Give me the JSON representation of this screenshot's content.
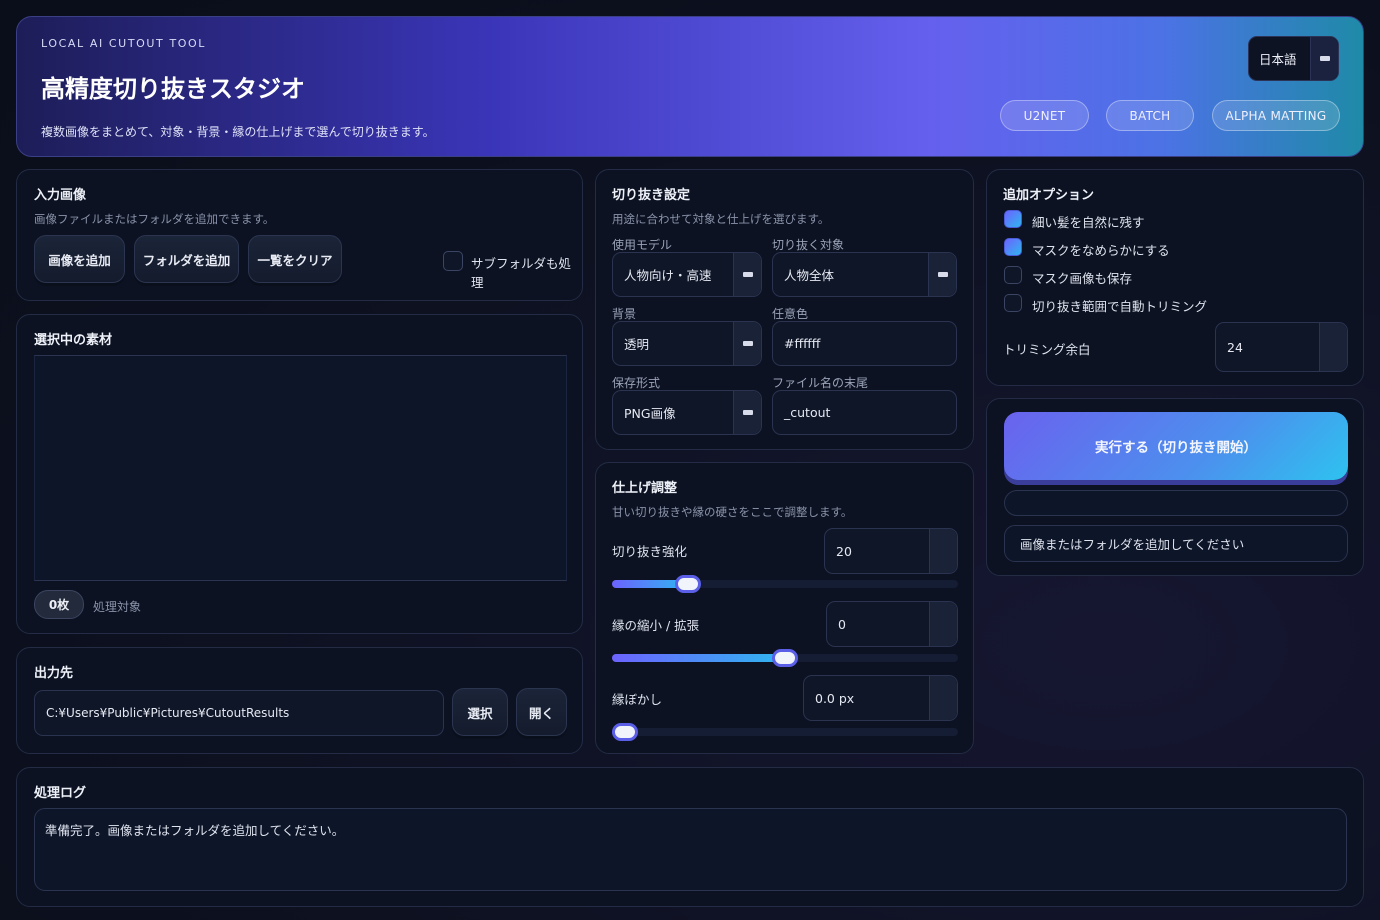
{
  "header": {
    "eyebrow": "LOCAL AI CUTOUT TOOL",
    "title": "高精度切り抜きスタジオ",
    "subtitle": "複数画像をまとめて、対象・背景・縁の仕上げまで選んで切り抜きます。",
    "language": "日本語",
    "badges": [
      "U2NET",
      "BATCH",
      "ALPHA MATTING"
    ]
  },
  "input_panel": {
    "title": "入力画像",
    "subtitle": "画像ファイルまたはフォルダを追加できます。",
    "add_images": "画像を追加",
    "add_folder": "フォルダを追加",
    "clear_list": "一覧をクリア",
    "subfolder_label": "サブフォルダも処理",
    "subfolder_checked": false
  },
  "selection_panel": {
    "title": "選択中の素材",
    "count": "0枚",
    "count_label": "処理対象"
  },
  "output_panel": {
    "title": "出力先",
    "path": "C:¥Users¥Public¥Pictures¥CutoutResults",
    "select": "選択",
    "open": "開く"
  },
  "cutout_settings": {
    "title": "切り抜き設定",
    "subtitle": "用途に合わせて対象と仕上げを選びます。",
    "model_label": "使用モデル",
    "model_value": "人物向け・高速",
    "target_label": "切り抜く対象",
    "target_value": "人物全体",
    "background_label": "背景",
    "background_value": "透明",
    "color_label": "任意色",
    "color_value": "#ffffff",
    "format_label": "保存形式",
    "format_value": "PNG画像",
    "suffix_label": "ファイル名の末尾",
    "suffix_value": "_cutout"
  },
  "finish_panel": {
    "title": "仕上げ調整",
    "subtitle": "甘い切り抜きや縁の硬さをここで調整します。",
    "strength_label": "切り抜き強化",
    "strength_value": "20",
    "strength_fraction": 0.22,
    "edge_label": "縁の縮小 / 拡張",
    "edge_value": "0",
    "edge_fraction": 0.5,
    "blur_label": "縁ぼかし",
    "blur_value": "0.0 px",
    "blur_fraction": 0.0
  },
  "options_panel": {
    "title": "追加オプション",
    "options": [
      {
        "label": "細い髪を自然に残す",
        "checked": true
      },
      {
        "label": "マスクをなめらかにする",
        "checked": true
      },
      {
        "label": "マスク画像も保存",
        "checked": false
      },
      {
        "label": "切り抜き範囲で自動トリミング",
        "checked": false
      }
    ],
    "trim_label": "トリミング余白",
    "trim_value": "24"
  },
  "run_panel": {
    "run_button": "実行する（切り抜き開始）",
    "progress": 0,
    "status": "画像またはフォルダを追加してください"
  },
  "log_panel": {
    "title": "処理ログ",
    "text": "準備完了。画像またはフォルダを追加してください。"
  },
  "colors": {
    "accent": "#6c63ff",
    "accent2": "#2fb6f0",
    "background": "#0a0e1a",
    "panel": "#0c1222"
  }
}
